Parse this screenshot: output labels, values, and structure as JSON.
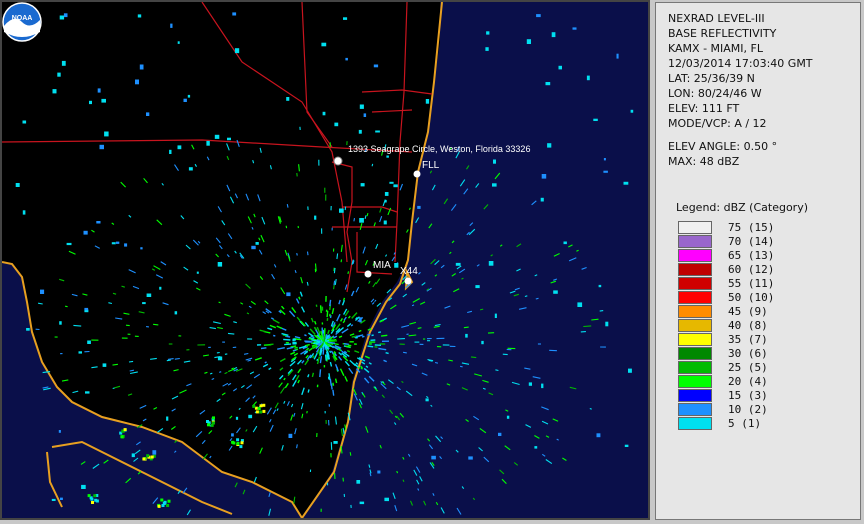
{
  "map": {
    "labels": {
      "address": "1393 Seagrape Circle, Weston, Florida 33326",
      "fll": "FLL",
      "mia": "MIA",
      "x44": "X44"
    },
    "colors": {
      "ocean": "#0a0f4a",
      "coast": "#e8a020",
      "roads": "#c8141e"
    },
    "logo_text": "NOAA"
  },
  "info": {
    "lines": [
      "NEXRAD LEVEL-III",
      "BASE REFLECTIVITY",
      "KAMX - MIAMI, FL",
      "12/03/2014 17:03:40 GMT",
      "LAT: 25/36/39 N",
      "LON: 80/24/46 W",
      "ELEV: 111 FT",
      "MODE/VCP: A / 12"
    ],
    "lines2": [
      "ELEV ANGLE: 0.50 °",
      "MAX: 48 dBZ"
    ]
  },
  "legend": {
    "title": "Legend: dBZ (Category)",
    "items": [
      {
        "label": "75  (15)",
        "color": "#f0f0f0"
      },
      {
        "label": "70  (14)",
        "color": "#9966cc"
      },
      {
        "label": "65  (13)",
        "color": "#ff00ff"
      },
      {
        "label": "60  (12)",
        "color": "#c00000"
      },
      {
        "label": "55  (11)",
        "color": "#d00000"
      },
      {
        "label": "50  (10)",
        "color": "#ff0000"
      },
      {
        "label": "45  (9)",
        "color": "#ff8c00"
      },
      {
        "label": "40  (8)",
        "color": "#e6b800"
      },
      {
        "label": "35  (7)",
        "color": "#ffff00"
      },
      {
        "label": "30  (6)",
        "color": "#008800"
      },
      {
        "label": "25  (5)",
        "color": "#00bb00"
      },
      {
        "label": "20  (4)",
        "color": "#00ff00"
      },
      {
        "label": "15  (3)",
        "color": "#0000ff"
      },
      {
        "label": "10  (2)",
        "color": "#1e90ff"
      },
      {
        "label": "5  (1)",
        "color": "#00e0f0"
      }
    ]
  }
}
